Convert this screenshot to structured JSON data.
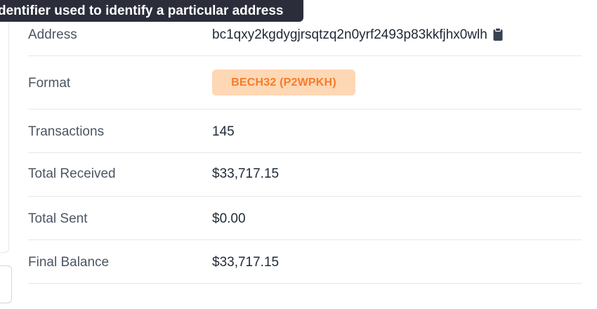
{
  "tooltip": {
    "text": "dentifier used to identify a particular address"
  },
  "rows": {
    "address": {
      "label": "Address",
      "value": "bc1qxy2kgdygjrsqtzq2n0yrf2493p83kkfjhx0wlh",
      "icon": "clipboard-icon"
    },
    "format": {
      "label": "Format",
      "value": "BECH32 (P2WPKH)"
    },
    "transactions": {
      "label": "Transactions",
      "value": "145"
    },
    "total_received": {
      "label": "Total Received",
      "value": "$33,717.15"
    },
    "total_sent": {
      "label": "Total Sent",
      "value": "$0.00"
    },
    "final_balance": {
      "label": "Final Balance",
      "value": "$33,717.15"
    }
  },
  "colors": {
    "badge_bg": "#fed7b5",
    "badge_text": "#f57c2a",
    "tooltip_bg": "#2b2d3a"
  }
}
